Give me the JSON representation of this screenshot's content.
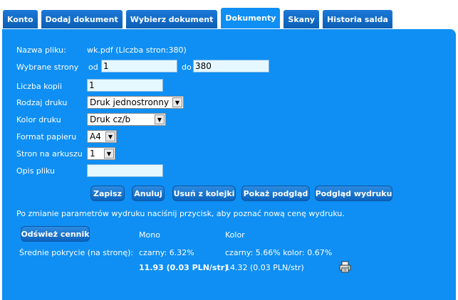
{
  "tabs": [
    "Konto",
    "Dodaj dokument",
    "Wybierz dokument",
    "Dokumenty",
    "Skany",
    "Historia salda"
  ],
  "active_tab": "Dokumenty",
  "form": {
    "file_name_label": "Nazwa pliku:",
    "file_name_value": "wk.pdf (Liczba stron:380)",
    "pages_label": "Wybrane strony",
    "pages_from_label": "od",
    "pages_from_value": "1",
    "pages_to_label": "do",
    "pages_to_value": "380",
    "copies_label": "Liczba kopii",
    "copies_value": "1",
    "print_type_label": "Rodzaj druku",
    "print_type_value": "Druk jednostronny",
    "print_color_label": "Kolor druku",
    "print_color_value": "Druk cz/b",
    "paper_format_label": "Format papieru",
    "paper_format_value": "A4",
    "pages_per_sheet_label": "Stron na arkuszu",
    "pages_per_sheet_value": "1",
    "description_label": "Opis pliku",
    "description_value": ""
  },
  "buttons": {
    "save": "Zapisz",
    "cancel": "Anuluj",
    "remove_from_queue": "Usuń z kolejki",
    "show_preview": "Pokaż podgląd",
    "print_preview": "Podgląd wydruku",
    "refresh_pricelist": "Odśwież cennik"
  },
  "info_text": "Po zmianie parametrów wydruku naciśnij przycisk, aby poznać nową cenę wydruku.",
  "pricing": {
    "mono_header": "Mono",
    "color_header": "Kolor",
    "coverage_label": "Średnie pokrycie (na stronę):",
    "mono_coverage": "czarny: 6.32%",
    "color_coverage": "czarny: 5.66% kolor: 0.67%",
    "mono_price": "11.93 (0.03 PLN/str)",
    "color_price": "14.32 (0.03 PLN/str)"
  },
  "colors": {
    "panel": "#0f8ff3",
    "tab": "#0b5fb4",
    "input_bg": "#e6f8ff"
  },
  "icons": {
    "print": "printer-icon"
  }
}
